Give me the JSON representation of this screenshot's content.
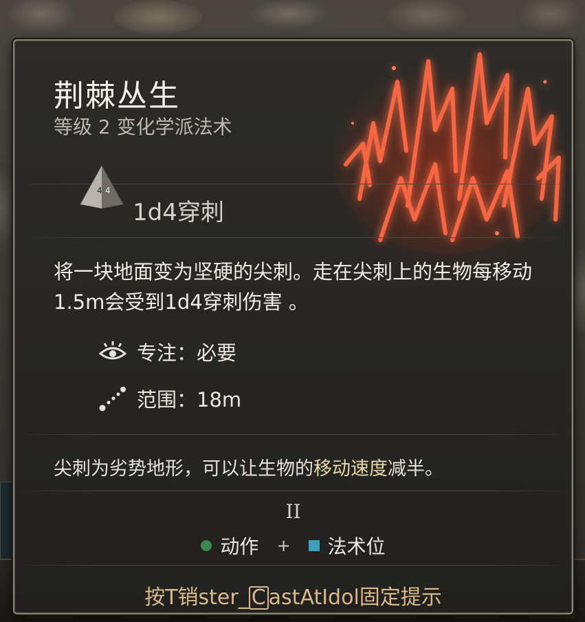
{
  "tooltip": {
    "title": "荆棘丛生",
    "subtitle": "等级 2 变化学派法术",
    "damage": "1d4穿刺",
    "description": "将一块地面变为坚硬的尖刺。走在尖刺上的生物每移动1.5m会受到1d4穿刺伤害 。",
    "concentration": "专注：必要",
    "range": "范围：18m",
    "note_prefix": "尖刺为劣势地形，可以让生物的",
    "note_highlight": "移动速度",
    "note_suffix": "减半。",
    "spell_level": "II",
    "cost_action": "动作",
    "cost_plus": "+",
    "cost_spell_slot": "法术位",
    "footer_prefix": "按T销ster_",
    "footer_key": "C",
    "footer_middle": "astAtIdol",
    "footer_suffix": "固定提示"
  },
  "icons": {
    "die": "d4-die-icon",
    "concentration": "concentration-eye-icon",
    "range": "range-dotted-line-icon",
    "spell_art": "spike-growth-spell-art"
  },
  "colors": {
    "spell_art": "#e2573a",
    "highlight": "#e8d7a8",
    "footer": "#d9b98a",
    "action_dot": "#3a8a4d",
    "spell_slot": "#3aa0c0"
  }
}
